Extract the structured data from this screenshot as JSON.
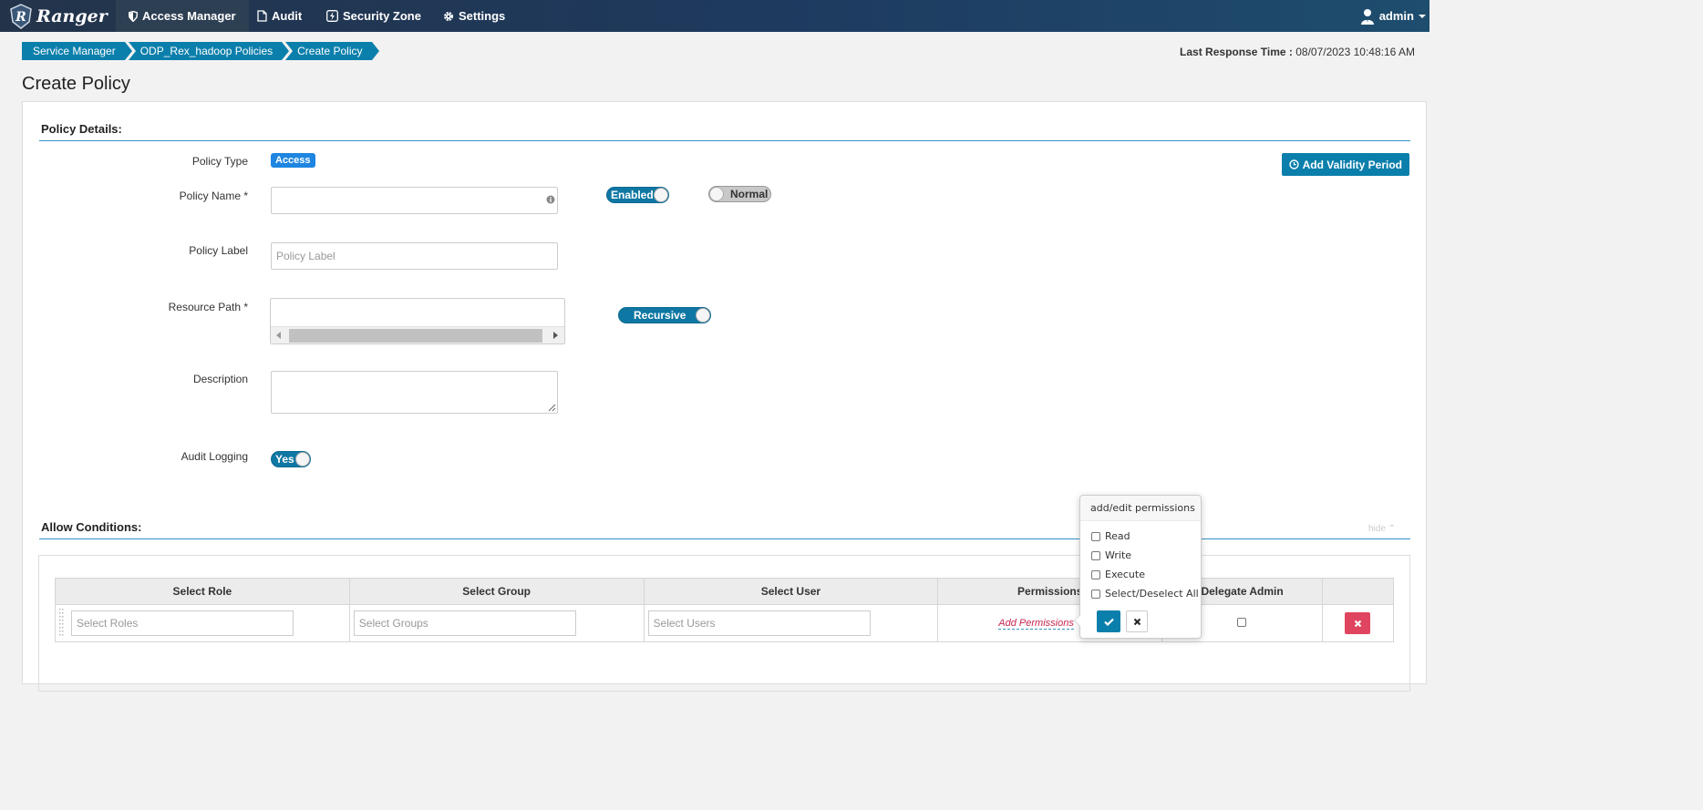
{
  "navbar": {
    "brand": "Ranger",
    "items": [
      {
        "label": "Access Manager",
        "icon": "shield-icon"
      },
      {
        "label": "Audit",
        "icon": "file-icon"
      },
      {
        "label": "Security Zone",
        "icon": "bolt-icon"
      },
      {
        "label": "Settings",
        "icon": "gear-icon"
      }
    ],
    "user": "admin"
  },
  "breadcrumb": [
    "Service Manager",
    "ODP_Rex_hadoop Policies",
    "Create Policy"
  ],
  "last_response": {
    "label": "Last Response Time :",
    "value": "08/07/2023 10:48:16 AM"
  },
  "page_title": "Create Policy",
  "policy_details": {
    "title": "Policy Details:",
    "policy_type_label": "Policy Type",
    "policy_type_value": "Access",
    "policy_name_label": "Policy Name *",
    "policy_name_value": "",
    "policy_label_label": "Policy Label",
    "policy_label_placeholder": "Policy Label",
    "resource_path_label": "Resource Path *",
    "description_label": "Description",
    "audit_logging_label": "Audit Logging",
    "toggles": {
      "enabled": "Enabled",
      "normal": "Normal",
      "recursive": "Recursive",
      "audit": "Yes"
    },
    "add_validity_period": "Add Validity Period"
  },
  "allow_conditions": {
    "title": "Allow Conditions:",
    "hide_label": "hide",
    "columns": [
      "Select Role",
      "Select Group",
      "Select User",
      "Permissions",
      "Delegate Admin",
      ""
    ],
    "row": {
      "roles_placeholder": "Select Roles",
      "groups_placeholder": "Select Groups",
      "users_placeholder": "Select Users",
      "add_permissions": "Add Permissions"
    }
  },
  "permissions_popover": {
    "title": "add/edit permissions",
    "options": [
      "Read",
      "Write",
      "Execute",
      "Select/Deselect All"
    ]
  },
  "colors": {
    "accent": "#0b7fab",
    "danger": "#e0455f",
    "navbar": "#1e3a5f",
    "badge": "#1e86e0"
  }
}
